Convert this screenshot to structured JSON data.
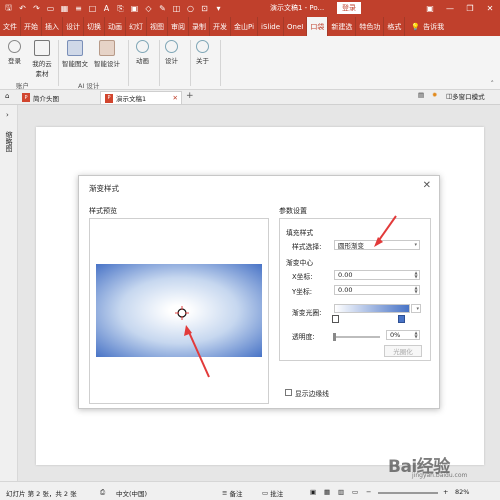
{
  "app": {
    "title": "演示文稿1 - Po...",
    "login_label": "登录"
  },
  "tabs": [
    "文件",
    "开始",
    "插入",
    "设计",
    "切换",
    "动画",
    "幻灯",
    "视图",
    "审阅",
    "录制",
    "开发",
    "金山Pi",
    "iSlide",
    "OneI",
    "口袋",
    "新建选",
    "特色功",
    "格式"
  ],
  "tell_me": "告诉我",
  "ribbon": {
    "buttons": [
      "登录",
      "我的云素材",
      "智能图文",
      "智能设计",
      "动画",
      "设计",
      "关于"
    ],
    "groups": [
      "账户",
      "AI 设计"
    ]
  },
  "doc_tabs": {
    "items": [
      "简介头图",
      "演示文稿1"
    ],
    "multi_window": "多窗口模式"
  },
  "sidebar": {
    "label": "缩略图"
  },
  "dialog": {
    "title": "渐变样式",
    "preview_title": "样式预览",
    "params_title": "参数设置",
    "fill_style_label": "填充样式",
    "style_select_label": "样式选择:",
    "style_select_value": "圆形渐变",
    "center_label": "渐变中心",
    "x_label": "X坐标:",
    "x_value": "0.00",
    "y_label": "Y坐标:",
    "y_value": "0.00",
    "aperture_label": "渐变光圈:",
    "transparency_label": "透明度:",
    "transparency_value": "0%",
    "apply_button": "光圈化",
    "show_border_label": "显示边缘线"
  },
  "status": {
    "slide_info": "幻灯片 第 2 张，共 2 张",
    "language": "中文(中国)",
    "notes": "备注",
    "comments": "批注",
    "zoom": "82%"
  },
  "watermark": {
    "text": "Bai经验",
    "sub": "jingyan.baidu.com"
  },
  "colors": {
    "accent": "#c0402c",
    "gradient_start": "#ffffff",
    "gradient_end": "#4873c6"
  }
}
